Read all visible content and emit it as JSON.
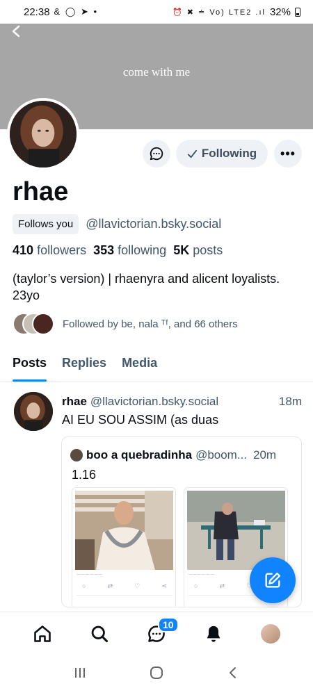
{
  "status_bar": {
    "time": "22:38",
    "left_icons": "& ◯ ➤ •",
    "right_icons": "⏰ ✖ ≐ Vo) LTE2 .ıl",
    "battery": "32%"
  },
  "banner": {
    "text": "come with me",
    "color": "#a6a6a6"
  },
  "profile": {
    "display_name": "rhae",
    "follows_you": "Follows you",
    "handle": "@llavictorian.bsky.social",
    "followers_count": "410",
    "followers_label": "followers",
    "following_count": "353",
    "following_label": "following",
    "posts_count": "5K",
    "posts_label": "posts",
    "bio": "(taylor’s version) | rhaenyra and alicent loyalists. 23yo",
    "followed_by": "Followed by be, nala ᵀᶠ, and 66 others"
  },
  "actions": {
    "following_label": "Following",
    "more_label": "•••"
  },
  "tabs": [
    {
      "label": "Posts",
      "active": true
    },
    {
      "label": "Replies",
      "active": false
    },
    {
      "label": "Media",
      "active": false
    }
  ],
  "post": {
    "name": "rhae",
    "handle": "@llavictorian.bsky.social",
    "time": "18m",
    "text": "AI EU SOU ASSIM (as duas",
    "quote": {
      "name": "boo a quebradinha",
      "handle": "@boom...",
      "time": "20m",
      "text": "1.16"
    }
  },
  "bottom_nav": {
    "messages_badge": "10"
  },
  "colors": {
    "accent": "#1083fe",
    "muted": "#42576c",
    "button_bg": "#eef2f6"
  },
  "icons": [
    "back-icon",
    "message-icon",
    "check-icon",
    "more-icon",
    "compose-icon",
    "home-icon",
    "search-icon",
    "chat-icon",
    "bell-icon",
    "recent-apps-icon",
    "home-circle-icon",
    "back-arrow-icon"
  ]
}
